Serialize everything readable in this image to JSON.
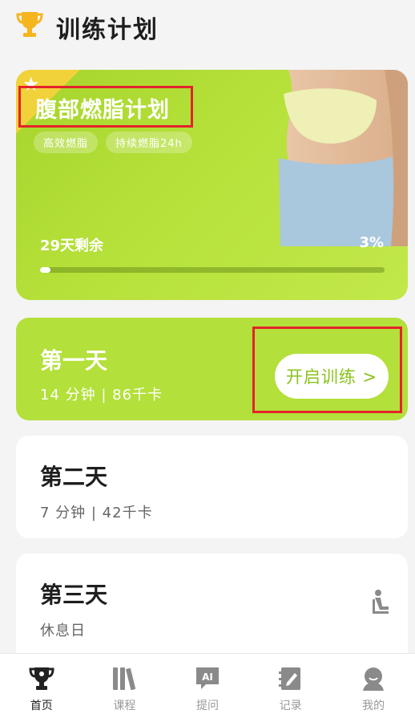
{
  "header": {
    "title": "训练计划",
    "icon": "trophy-icon"
  },
  "plan": {
    "title": "腹部燃脂计划",
    "tags": [
      "高效燃脂",
      "持续燃脂24h"
    ],
    "days_left": "29天剩余",
    "progress_text": "3%",
    "progress": 0.03,
    "accent": "#b3e03a"
  },
  "days": [
    {
      "title": "第一天",
      "meta": "14 分钟 | 86千卡",
      "button": "开启训练 >"
    },
    {
      "title": "第二天",
      "meta": "7 分钟 | 42千卡"
    },
    {
      "title": "第三天",
      "meta": "休息日"
    }
  ],
  "nav": {
    "items": [
      {
        "label": "首页",
        "icon": "trophy-icon",
        "active": true
      },
      {
        "label": "课程",
        "icon": "books-icon"
      },
      {
        "label": "提问",
        "icon": "ai-chat-icon"
      },
      {
        "label": "记录",
        "icon": "notebook-icon"
      },
      {
        "label": "我的",
        "icon": "profile-icon"
      }
    ]
  }
}
